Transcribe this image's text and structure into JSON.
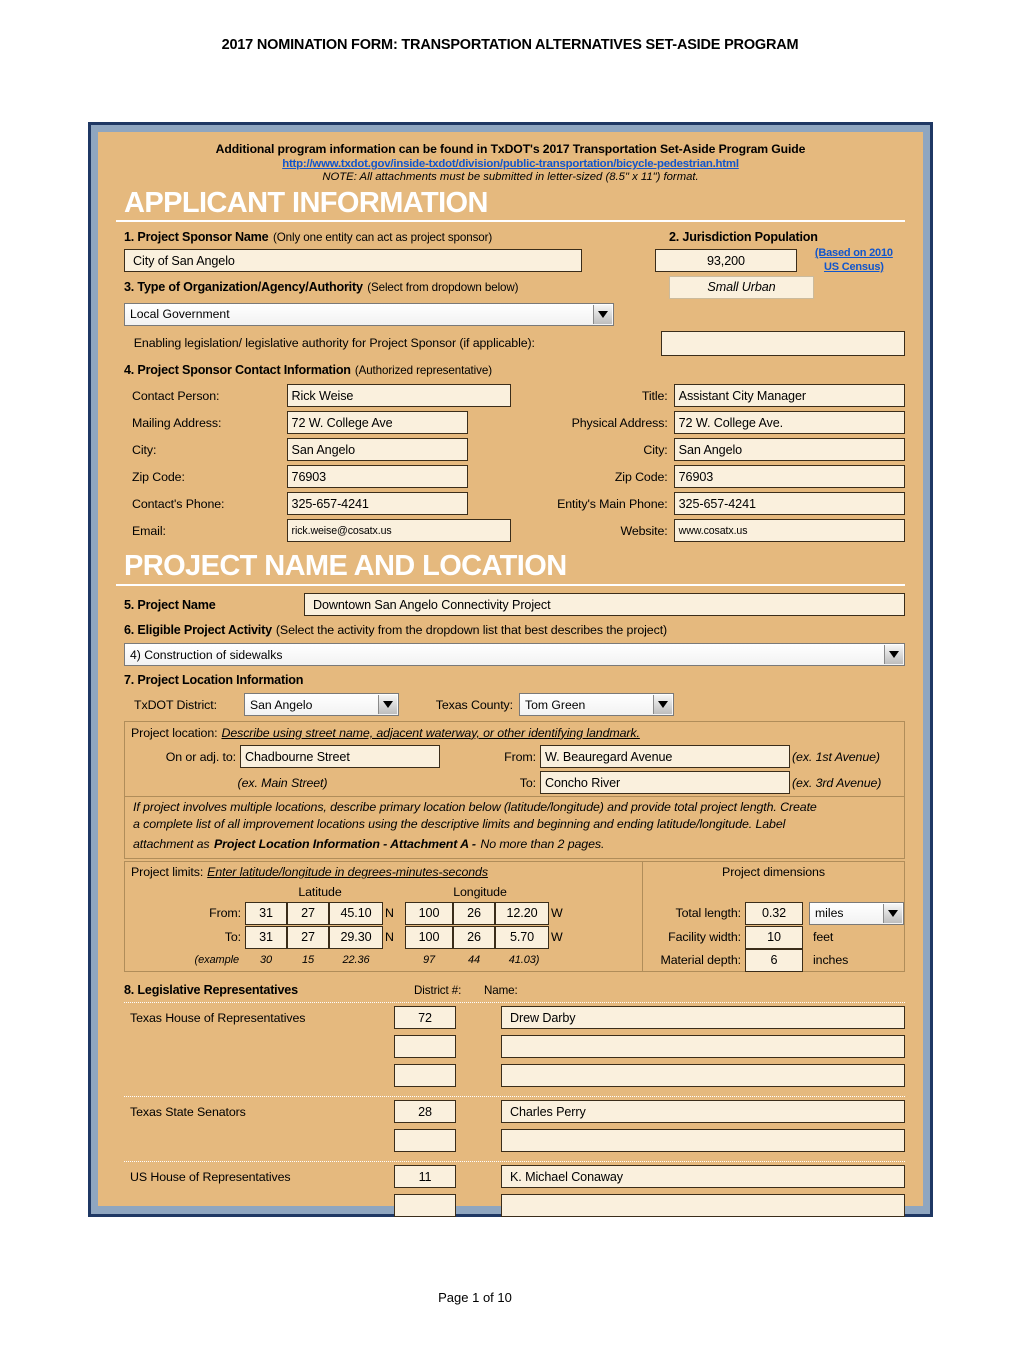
{
  "page_title": "2017 NOMINATION FORM: TRANSPORTATION ALTERNATIVES SET-ASIDE PROGRAM",
  "banner": {
    "line1": "Additional program information can be found in TxDOT's 2017 Transportation Set-Aside Program Guide",
    "link": "http://www.txdot.gov/inside-txdot/division/public-transportation/bicycle-pedestrian.html",
    "note": "NOTE: All attachments must be submitted in letter-sized (8.5\" x 11\") format."
  },
  "applicant": {
    "heading": "APPLICANT INFORMATION",
    "q1_label": "1. Project Sponsor Name",
    "q1_hint": "(Only one entity can act as project sponsor)",
    "sponsor_name": "City of San Angelo",
    "q2_label": "2. Jurisdiction Population",
    "population": "93,200",
    "population_class": "Small Urban",
    "census_note_1": "(Based on 2010",
    "census_note_2": "US Census)",
    "q3_label": "3. Type of Organization/Agency/Authority",
    "q3_hint": "(Select from dropdown below)",
    "org_type": "Local Government",
    "enabling_label": "Enabling legislation/ legislative authority for Project Sponsor (if applicable):",
    "enabling_value": "",
    "q4_label": "4. Project Sponsor Contact Information",
    "q4_hint": "(Authorized representative)",
    "contact_left": [
      {
        "label": "Contact Person:",
        "value": "Rick Weise"
      },
      {
        "label": "Mailing Address:",
        "value": "72 W. College Ave"
      },
      {
        "label": "City:",
        "value": "San Angelo"
      },
      {
        "label": "Zip Code:",
        "value": "76903"
      },
      {
        "label": "Contact's Phone:",
        "value": "325-657-4241"
      },
      {
        "label": "Email:",
        "value": "rick.weise@cosatx.us"
      }
    ],
    "contact_right": [
      {
        "label": "Title:",
        "value": "Assistant City Manager"
      },
      {
        "label": "Physical Address:",
        "value": "72 W. College Ave."
      },
      {
        "label": "City:",
        "value": "San Angelo"
      },
      {
        "label": "Zip Code:",
        "value": "76903"
      },
      {
        "label": "Entity's Main Phone:",
        "value": "325-657-4241"
      },
      {
        "label": "Website:",
        "value": "www.cosatx.us"
      }
    ]
  },
  "project": {
    "heading": "PROJECT NAME AND LOCATION",
    "q5_label": "5. Project Name",
    "project_name": "Downtown San Angelo Connectivity Project",
    "q6_label": "6. Eligible Project Activity",
    "q6_hint": "(Select the activity from the dropdown list that best describes the project)",
    "activity": "4) Construction of sidewalks",
    "q7_label": "7. Project Location Information",
    "district_label": "TxDOT District:",
    "district": "San Angelo",
    "county_label": "Texas County:",
    "county": "Tom Green",
    "location_label": "Project location:",
    "location_hint": "Describe using street name, adjacent waterway, or other identifying landmark.",
    "on_adj_label": "On or adj. to:",
    "on_adj_value": "Chadbourne Street",
    "on_adj_example": "(ex. Main Street)",
    "from_label": "From:",
    "from_value": "W. Beauregard Avenue",
    "from_example": "(ex. 1st Avenue)",
    "to_label": "To:",
    "to_value": "Concho River",
    "to_example": "(ex. 3rd Avenue)",
    "multi_note_a": "If project involves multiple locations, describe primary location below (latitude/longitude) and provide total project length. Create",
    "multi_note_b": "a complete list of all improvement locations using the descriptive limits and beginning and ending latitude/longitude. Label",
    "multi_note_c": "attachment as",
    "multi_note_bold": "Project Location Information - Attachment A -",
    "multi_note_d": "No more than 2 pages.",
    "limits_label": "Project limits:",
    "limits_hint": "Enter latitude/longitude in degrees-minutes-seconds",
    "lat_header": "Latitude",
    "lon_header": "Longitude",
    "rows": [
      {
        "label": "From:",
        "lat_d": "31",
        "lat_m": "27",
        "lat_s": "45.10",
        "lat_dir": "N",
        "lon_d": "100",
        "lon_m": "26",
        "lon_s": "12.20",
        "lon_dir": "W"
      },
      {
        "label": "To:",
        "lat_d": "31",
        "lat_m": "27",
        "lat_s": "29.30",
        "lat_dir": "N",
        "lon_d": "100",
        "lon_m": "26",
        "lon_s": "5.70",
        "lon_dir": "W"
      }
    ],
    "example_label": "(example",
    "example": {
      "lat_d": "30",
      "lat_m": "15",
      "lat_s": "22.36",
      "lon_d": "97",
      "lon_m": "44",
      "lon_s": "41.03)"
    },
    "dimensions_title": "Project dimensions",
    "total_length_label": "Total length:",
    "total_length_value": "0.32",
    "total_length_unit": "miles",
    "facility_width_label": "Facility width:",
    "facility_width_value": "10",
    "facility_width_unit": "feet",
    "material_depth_label": "Material depth:",
    "material_depth_value": "6",
    "material_depth_unit": "inches"
  },
  "legislative": {
    "q8_label": "8. Legislative Representatives",
    "district_col": "District #:",
    "name_col": "Name:",
    "groups": [
      {
        "title": "Texas House of Representatives",
        "rows": [
          {
            "district": "72",
            "name": "Drew Darby"
          },
          {
            "district": "",
            "name": ""
          },
          {
            "district": "",
            "name": ""
          }
        ]
      },
      {
        "title": "Texas State Senators",
        "rows": [
          {
            "district": "28",
            "name": "Charles Perry"
          },
          {
            "district": "",
            "name": ""
          }
        ]
      },
      {
        "title": "US House of Representatives",
        "rows": [
          {
            "district": "11",
            "name": "K. Michael Conaway"
          },
          {
            "district": "",
            "name": ""
          }
        ]
      }
    ]
  },
  "footer": "Page 1 of 10",
  "colors": {
    "body": "#e5b97e",
    "field": "#faf0dd",
    "frame": "#1f3864",
    "frame_inner": "#8fa6c0",
    "link": "#1155cc"
  }
}
